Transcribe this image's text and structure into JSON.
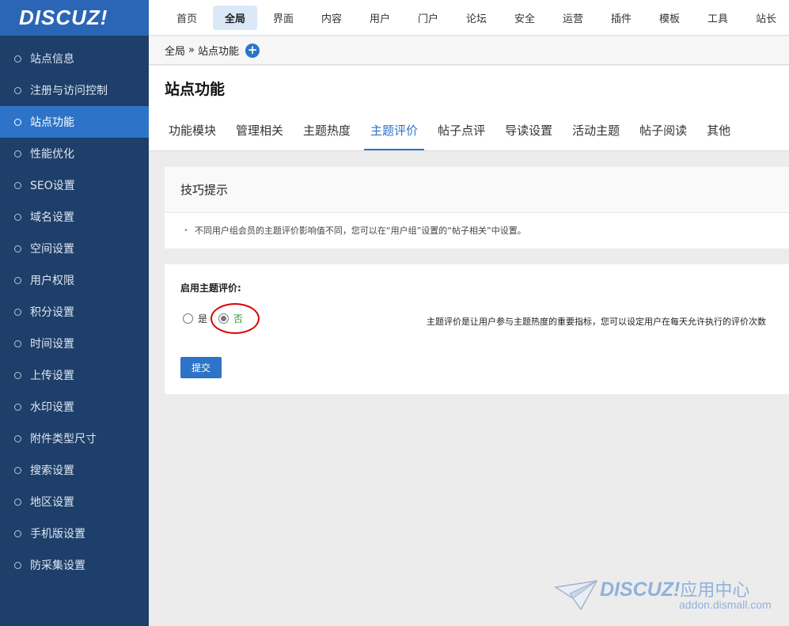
{
  "logo": {
    "text": "DISCUZ!"
  },
  "sidebar": {
    "items": [
      {
        "label": "站点信息"
      },
      {
        "label": "注册与访问控制"
      },
      {
        "label": "站点功能",
        "active": true
      },
      {
        "label": "性能优化"
      },
      {
        "label": "SEO设置"
      },
      {
        "label": "域名设置"
      },
      {
        "label": "空间设置"
      },
      {
        "label": "用户权限"
      },
      {
        "label": "积分设置"
      },
      {
        "label": "时间设置"
      },
      {
        "label": "上传设置"
      },
      {
        "label": "水印设置"
      },
      {
        "label": "附件类型尺寸"
      },
      {
        "label": "搜索设置"
      },
      {
        "label": "地区设置"
      },
      {
        "label": "手机版设置"
      },
      {
        "label": "防采集设置"
      }
    ]
  },
  "topnav": {
    "items": [
      {
        "label": "首页"
      },
      {
        "label": "全局",
        "active": true
      },
      {
        "label": "界面"
      },
      {
        "label": "内容"
      },
      {
        "label": "用户"
      },
      {
        "label": "门户"
      },
      {
        "label": "论坛"
      },
      {
        "label": "安全"
      },
      {
        "label": "运营"
      },
      {
        "label": "插件"
      },
      {
        "label": "模板"
      },
      {
        "label": "工具"
      },
      {
        "label": "站长"
      }
    ]
  },
  "breadcrumb": {
    "parent": "全局",
    "separator": "»",
    "current": "站点功能",
    "add_icon": "+"
  },
  "page": {
    "title": "站点功能"
  },
  "tabs": [
    {
      "label": "功能模块"
    },
    {
      "label": "管理相关"
    },
    {
      "label": "主题热度"
    },
    {
      "label": "主题评价",
      "active": true
    },
    {
      "label": "帖子点评"
    },
    {
      "label": "导读设置"
    },
    {
      "label": "活动主题"
    },
    {
      "label": "帖子阅读"
    },
    {
      "label": "其他"
    }
  ],
  "tips": {
    "title": "技巧提示",
    "bullet": "•",
    "text": "不同用户组会员的主题评价影响值不同，您可以在“用户组”设置的“帖子相关”中设置。"
  },
  "settings": {
    "field_label": "启用主题评价:",
    "options": [
      {
        "label": "是",
        "checked": false
      },
      {
        "label": "否",
        "checked": true
      }
    ],
    "description": "主题评价是让用户参与主题热度的重要指标，您可以设定用户在每天允许执行的评价次数",
    "submit_label": "提交"
  },
  "watermark": {
    "brand": "DISCUZ!",
    "brand_cn": "应用中心",
    "url": "addon.dismall.com"
  },
  "colors": {
    "sidebar_bg": "#1e3f69",
    "accent": "#2d74c8",
    "highlight_ring": "#d90000",
    "selected_option": "#2a9c2a"
  }
}
